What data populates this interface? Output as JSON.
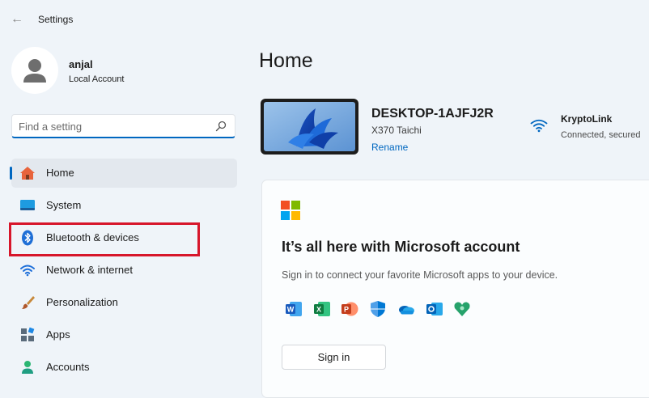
{
  "window": {
    "title": "Settings"
  },
  "profile": {
    "name": "anjal",
    "account_type": "Local Account"
  },
  "search": {
    "placeholder": "Find a setting",
    "value": ""
  },
  "nav": {
    "items": [
      {
        "label": "Home",
        "icon": "home-icon",
        "active": true
      },
      {
        "label": "System",
        "icon": "system-icon"
      },
      {
        "label": "Bluetooth & devices",
        "icon": "bluetooth-icon"
      },
      {
        "label": "Network & internet",
        "icon": "wifi-icon"
      },
      {
        "label": "Personalization",
        "icon": "paintbrush-icon"
      },
      {
        "label": "Apps",
        "icon": "apps-icon"
      },
      {
        "label": "Accounts",
        "icon": "person-icon"
      }
    ]
  },
  "main": {
    "title": "Home",
    "device": {
      "name": "DESKTOP-1AJFJ2R",
      "model": "X370 Taichi",
      "rename_label": "Rename"
    },
    "network": {
      "name": "KryptoLink",
      "status": "Connected, secured"
    },
    "ms_card": {
      "title": "It’s all here with Microsoft account",
      "description": "Sign in to connect your favorite Microsoft apps to your device.",
      "apps": [
        "word-icon",
        "excel-icon",
        "powerpoint-icon",
        "defender-icon",
        "onedrive-icon",
        "outlook-icon",
        "family-icon"
      ],
      "signin_label": "Sign in"
    }
  },
  "colors": {
    "accent": "#0067c0",
    "highlight": "#d7162b",
    "background": "#eff4f9"
  }
}
